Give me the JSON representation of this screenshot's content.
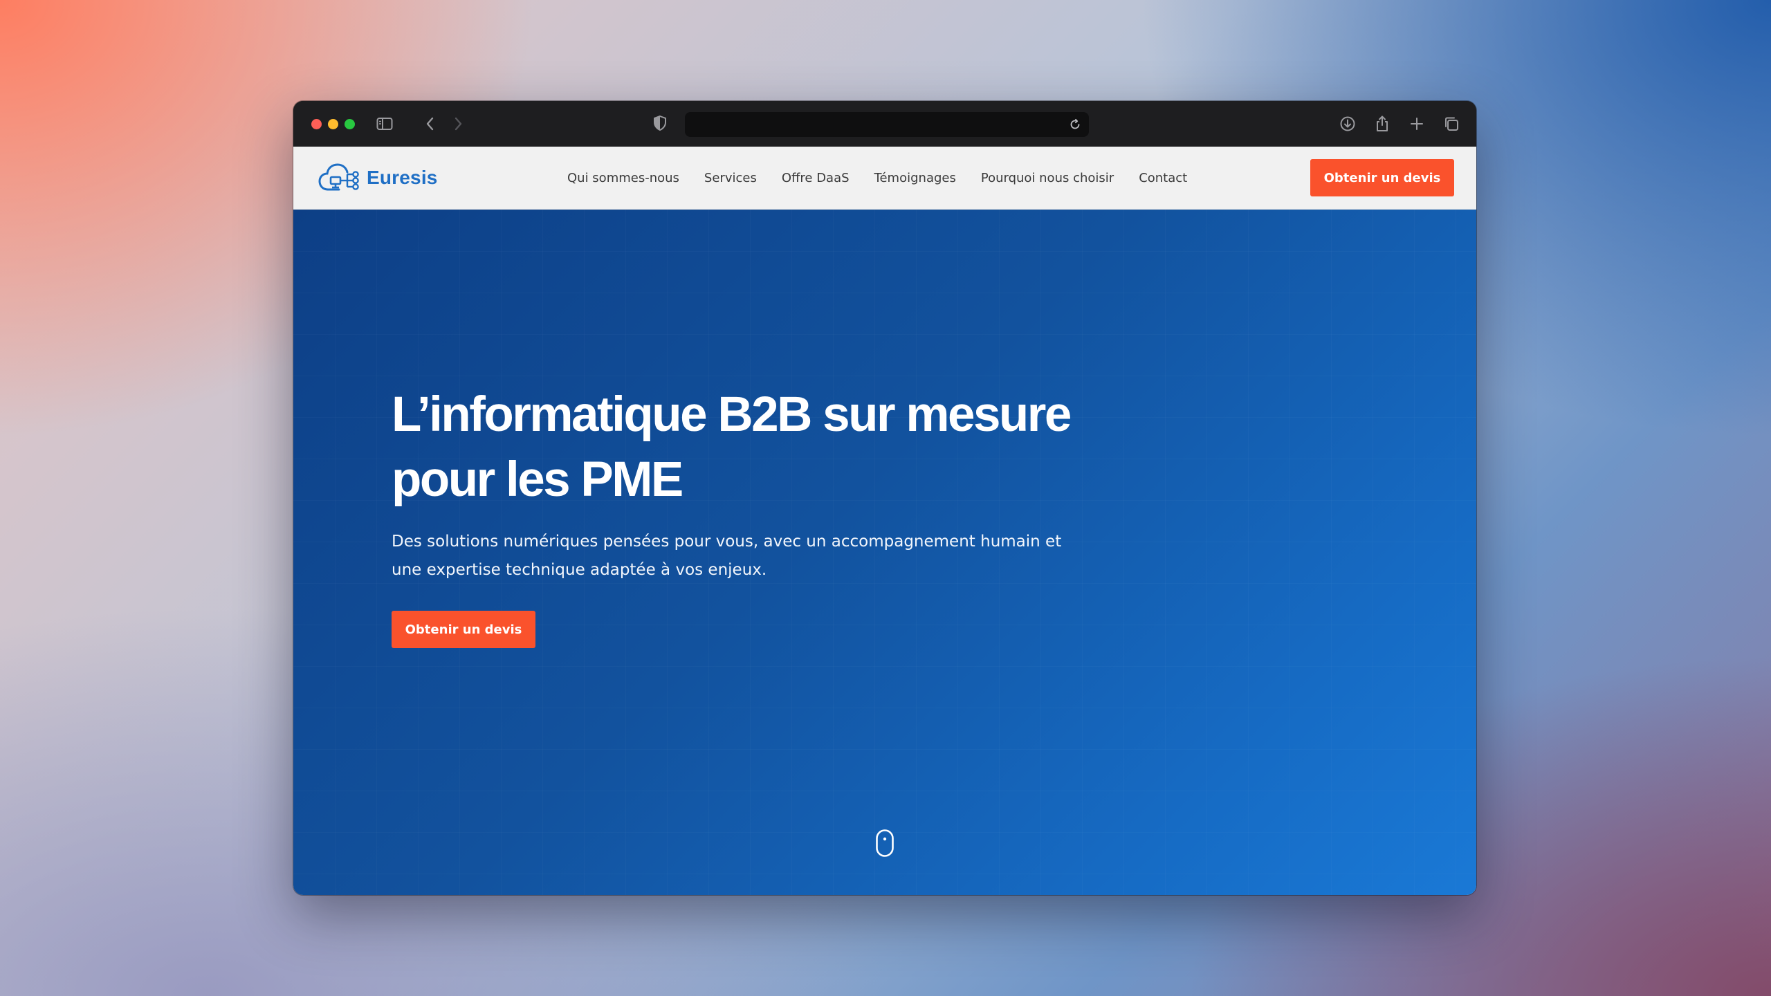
{
  "browser": {
    "buttons": {
      "sidebar": "sidebar-toggle",
      "back": "back",
      "forward": "forward",
      "reload": "reload",
      "download": "download",
      "share": "share",
      "new_tab": "new-tab",
      "tabs_overview": "tabs-overview"
    },
    "address": ""
  },
  "site": {
    "brand": "Euresis",
    "nav": [
      "Qui sommes-nous",
      "Services",
      "Offre DaaS",
      "Témoignages",
      "Pourquoi nous choisir",
      "Contact"
    ],
    "cta_label": "Obtenir un devis"
  },
  "hero": {
    "title_line1": "L’informatique B2B sur mesure",
    "title_line2": "pour les PME",
    "subtitle_line1": "Des solutions numériques pensées pour vous, avec un accompagnement humain et",
    "subtitle_line2": "une expertise technique adaptée à vos enjeux.",
    "cta_label": "Obtenir un devis"
  },
  "colors": {
    "accent": "#fa522c",
    "brand_blue": "#1f6fc5",
    "hero_start": "#0d3f86",
    "hero_end": "#1a79d6"
  }
}
